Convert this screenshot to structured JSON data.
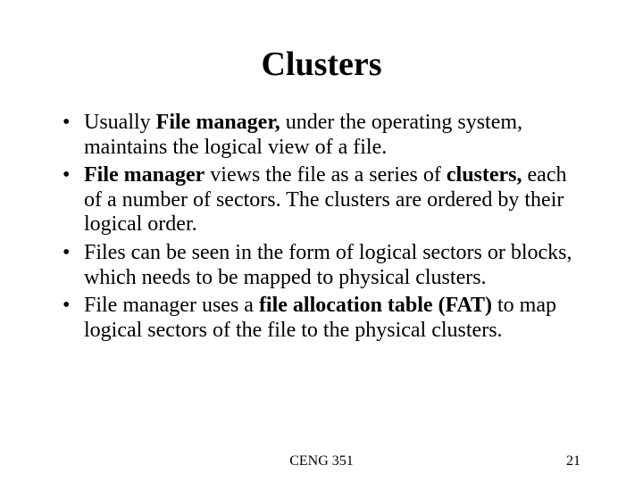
{
  "title": "Clusters",
  "bullets": {
    "b1": {
      "pre": "Usually ",
      "bold": "File manager,",
      "post": " under the operating system, maintains the logical view of a file."
    },
    "b2": {
      "bold1": "File manager",
      "mid1": " views the file as a series of ",
      "bold2": "clusters,",
      "post": " each  of a number of sectors. The clusters are ordered by their logical order."
    },
    "b3": {
      "text": "Files can be seen in the form of logical sectors or blocks, which needs to be mapped to physical clusters."
    },
    "b4": {
      "pre": "File manager uses a ",
      "bold": "file allocation table (FAT)",
      "post": " to map logical sectors of the file to the physical clusters."
    }
  },
  "footer": {
    "course": "CENG 351",
    "page": "21"
  }
}
